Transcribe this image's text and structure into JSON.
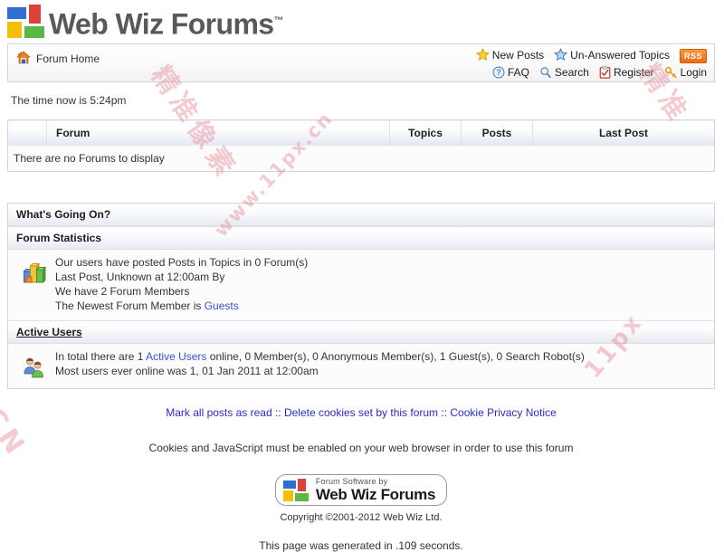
{
  "header": {
    "logo_text": "Web Wiz Forums",
    "trademark": "™",
    "logo_icon": "four-squares-logo"
  },
  "nav": {
    "breadcrumb": "Forum Home",
    "breadcrumb_icon": "home-icon",
    "row1": [
      {
        "label": "New Posts",
        "icon": "yellow-star-icon"
      },
      {
        "label": "Un-Answered Topics",
        "icon": "blue-star-icon"
      },
      {
        "label": "RSS",
        "icon": "rss-badge-icon"
      }
    ],
    "row2": [
      {
        "label": "FAQ",
        "icon": "question-mark-icon"
      },
      {
        "label": "Search",
        "icon": "magnifier-icon"
      },
      {
        "label": "Register",
        "icon": "clipboard-icon"
      },
      {
        "label": "Login",
        "icon": "key-icon"
      }
    ]
  },
  "time_row": "The time now is 5:24pm",
  "forum_table": {
    "columns": [
      "",
      "Forum",
      "Topics",
      "Posts",
      "Last Post"
    ],
    "empty_message": "There are no Forums to display"
  },
  "whats_going_on": {
    "title": "What's Going On?",
    "statistics": {
      "title": "Forum Statistics",
      "icon": "bar-chart-icon",
      "lines": [
        "Our users have posted Posts in Topics in 0 Forum(s)",
        "Last Post, Unknown at 12:00am By",
        "We have 2 Forum Members"
      ],
      "newest_member_prefix": "The Newest Forum Member is ",
      "newest_member_name": "Guests"
    },
    "active_users": {
      "title": "Active Users",
      "icon": "two-users-icon",
      "line1_prefix": "In total there are 1 ",
      "line1_link": "Active Users",
      "line1_suffix": " online, 0 Member(s), 0 Anonymous Member(s), 1 Guest(s), 0 Search Robot(s)",
      "line2": "Most users ever online was 1, 01 Jan 2011 at 12:00am"
    }
  },
  "footer": {
    "links": [
      "Mark all posts as read",
      "Delete cookies set by this forum",
      "Cookie Privacy Notice"
    ],
    "separator": " :: ",
    "note": "Cookies and JavaScript must be enabled on your web browser in order to use this forum",
    "badge_top": "Forum Software by",
    "badge_main": "Web Wiz Forums",
    "badge_icon": "four-squares-logo",
    "copyright": "Copyright ©2001-2012 Web Wiz Ltd.",
    "generated": "This page was generated in .109 seconds."
  },
  "watermark": {
    "a": "精准像素",
    "b": "www.11px.cn",
    "c": "精准",
    "d": ".CN",
    "e": "11px"
  },
  "colors": {
    "link_blue": "#3355cc",
    "footer_link": "#2b2bc4",
    "rss_orange": "#ec6b12",
    "logo_gray": "#595959",
    "border": "#d4d4d4"
  }
}
